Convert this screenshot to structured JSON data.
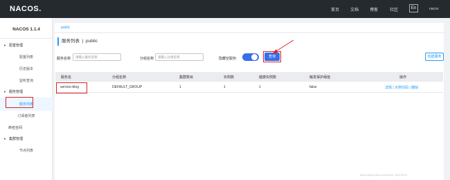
{
  "topbar": {
    "logo": "NACOS.",
    "nav": [
      "首页",
      "文档",
      "博客",
      "社区"
    ],
    "lang": "En",
    "user": "nacos"
  },
  "sidebar": {
    "title": "NACOS 1.1.4",
    "groups": [
      {
        "label": "配置管理",
        "items": [
          "配置列表",
          "历史版本",
          "监听查询"
        ]
      },
      {
        "label": "服务管理",
        "items": [
          "服务列表",
          "订阅者列表"
        ]
      },
      {
        "label": "命名空间",
        "items": []
      },
      {
        "label": "集群管理",
        "items": [
          "节点列表"
        ]
      }
    ],
    "active_item": "服务列表"
  },
  "breadcrumb": "public",
  "page": {
    "title": "服务列表",
    "namespace": "public",
    "filters": {
      "service_name_label": "服务名称",
      "service_name_placeholder": "请输入服务名称",
      "group_name_label": "分组名称",
      "group_name_placeholder": "请输入分组名称",
      "hide_empty_label": "隐藏空服务:",
      "hide_empty_on": true
    },
    "query_button": "查询",
    "create_button": "创建服务"
  },
  "table": {
    "headers": [
      "服务名",
      "分组名称",
      "集群数目",
      "实例数",
      "健康实例数",
      "触发保护阈值",
      "操作"
    ],
    "rows": [
      {
        "service": "service-blog",
        "group": "DEFAULT_GROUP",
        "clusters": "1",
        "instances": "1",
        "healthy": "1",
        "threshold": "false",
        "ops": [
          "详情",
          "示例代码",
          "删除"
        ]
      }
    ]
  },
  "colors": {
    "accent": "#209bfa",
    "primary_button": "#3a6ee8",
    "highlight": "#d9222a",
    "topbar": "#252a2f"
  },
  "watermark": "https://blog.csdn.net/weixin_45073478"
}
